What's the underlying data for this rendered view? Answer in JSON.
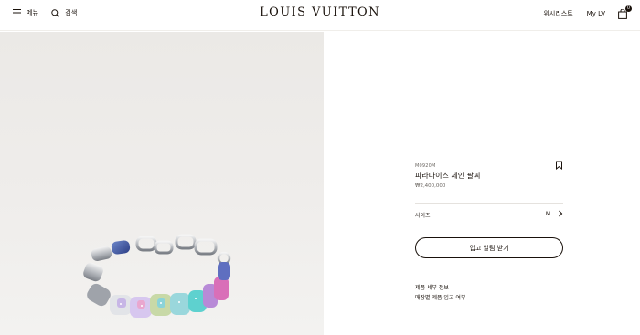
{
  "header": {
    "menu_label": "메뉴",
    "search_label": "검색",
    "brand": "LOUIS VUITTON",
    "wishlist_label": "위시리스트",
    "account_label": "My LV",
    "bag_count": "0"
  },
  "product": {
    "sku": "M0920M",
    "title": "파라다이스 체인 팔찌",
    "price": "₩2,400,000",
    "size_label": "사이즈",
    "size_value": "M",
    "cta_label": "입고 알림 받기",
    "details_link": "제품 세부 정보",
    "store_stock_link": "매장별 제품 입고 여부"
  },
  "colors": {
    "text": "#19110b",
    "image_background": "#efedeb"
  }
}
